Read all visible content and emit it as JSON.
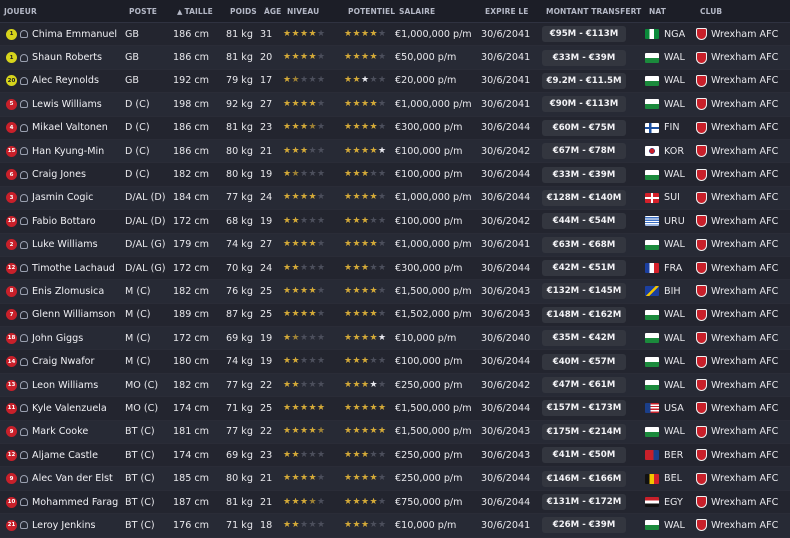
{
  "colors": {
    "accent_star": "#d4aa38",
    "shirt_field": "#c8202a",
    "shirt_gk": "#d7d41c"
  },
  "headers": {
    "joueur": "JOUEUR",
    "poste": "POSTE",
    "taille": "TAILLE",
    "poids": "POIDS",
    "age": "ÂGE",
    "niveau": "NIVEAU",
    "potentiel": "POTENTIEL",
    "salaire": "SALAIRE",
    "expire": "EXPIRE LE",
    "montant": "MONTANT TRANSFERT",
    "nat": "NAT",
    "club": "CLUB",
    "sort_indicator": "▲"
  },
  "players": [
    {
      "num": "1",
      "gk": true,
      "name": "Chima Emmanuel",
      "pos": "GB",
      "height": "186 cm",
      "weight": "81 kg",
      "age": "31",
      "ca": 4,
      "pa": 4,
      "salary": "€1,000,000 p/m",
      "expires": "30/6/2041",
      "value": "€95M - €113M",
      "nat": "NGA",
      "flag": "nga",
      "club": "Wrexham AFC"
    },
    {
      "num": "1",
      "gk": true,
      "name": "Shaun Roberts",
      "pos": "GB",
      "height": "186 cm",
      "weight": "81 kg",
      "age": "20",
      "ca": 4,
      "pa": 4,
      "salary": "€50,000 p/m",
      "expires": "30/6/2041",
      "value": "€33M - €39M",
      "nat": "WAL",
      "flag": "wal",
      "club": "Wrexham AFC"
    },
    {
      "num": "20",
      "gk": true,
      "name": "Alec Reynolds",
      "pos": "GB",
      "height": "192 cm",
      "weight": "79 kg",
      "age": "17",
      "ca": 1.5,
      "pa": 2.5,
      "salary": "€20,000 p/m",
      "expires": "30/6/2041",
      "value": "€9.2M - €11.5M",
      "nat": "WAL",
      "flag": "wal",
      "club": "Wrexham AFC"
    },
    {
      "num": "5",
      "gk": false,
      "name": "Lewis Williams",
      "pos": "D (C)",
      "height": "198 cm",
      "weight": "92 kg",
      "age": "27",
      "ca": 4,
      "pa": 4,
      "salary": "€1,000,000 p/m",
      "expires": "30/6/2041",
      "value": "€90M - €113M",
      "nat": "WAL",
      "flag": "wal",
      "club": "Wrexham AFC"
    },
    {
      "num": "4",
      "gk": false,
      "name": "Mikael Valtonen",
      "pos": "D (C)",
      "height": "186 cm",
      "weight": "81 kg",
      "age": "23",
      "ca": 3.5,
      "pa": 4,
      "salary": "€300,000 p/m",
      "expires": "30/6/2044",
      "value": "€60M - €75M",
      "nat": "FIN",
      "flag": "fin",
      "club": "Wrexham AFC"
    },
    {
      "num": "15",
      "gk": false,
      "name": "Han Kyung-Min",
      "pos": "D (C)",
      "height": "186 cm",
      "weight": "80 kg",
      "age": "21",
      "ca": 3,
      "pa": 4.5,
      "salary": "€100,000 p/m",
      "expires": "30/6/2042",
      "value": "€67M - €78M",
      "nat": "KOR",
      "flag": "kor",
      "club": "Wrexham AFC"
    },
    {
      "num": "6",
      "gk": false,
      "name": "Craig Jones",
      "pos": "D (C)",
      "height": "182 cm",
      "weight": "80 kg",
      "age": "19",
      "ca": 1.5,
      "pa": 3,
      "salary": "€100,000 p/m",
      "expires": "30/6/2044",
      "value": "€33M - €39M",
      "nat": "WAL",
      "flag": "wal",
      "club": "Wrexham AFC"
    },
    {
      "num": "3",
      "gk": false,
      "name": "Jasmin Cogic",
      "pos": "D/AL (D)",
      "height": "184 cm",
      "weight": "77 kg",
      "age": "24",
      "ca": 4,
      "pa": 4,
      "salary": "€1,000,000 p/m",
      "expires": "30/6/2044",
      "value": "€128M - €140M",
      "nat": "SUI",
      "flag": "sui",
      "club": "Wrexham AFC"
    },
    {
      "num": "19",
      "gk": false,
      "name": "Fabio Bottaro",
      "pos": "D/AL (D)",
      "height": "172 cm",
      "weight": "68 kg",
      "age": "19",
      "ca": 2,
      "pa": 3,
      "salary": "€100,000 p/m",
      "expires": "30/6/2042",
      "value": "€44M - €54M",
      "nat": "URU",
      "flag": "uru",
      "club": "Wrexham AFC"
    },
    {
      "num": "2",
      "gk": false,
      "name": "Luke Williams",
      "pos": "D/AL (G)",
      "height": "179 cm",
      "weight": "74 kg",
      "age": "27",
      "ca": 4,
      "pa": 4,
      "salary": "€1,000,000 p/m",
      "expires": "30/6/2041",
      "value": "€63M - €68M",
      "nat": "WAL",
      "flag": "wal",
      "club": "Wrexham AFC"
    },
    {
      "num": "12",
      "gk": false,
      "name": "Timothe Lachaud",
      "pos": "D/AL (G)",
      "height": "172 cm",
      "weight": "70 kg",
      "age": "24",
      "ca": 2,
      "pa": 3,
      "salary": "€300,000 p/m",
      "expires": "30/6/2044",
      "value": "€42M - €51M",
      "nat": "FRA",
      "flag": "fra",
      "club": "Wrexham AFC"
    },
    {
      "num": "8",
      "gk": false,
      "name": "Enis Zlomusica",
      "pos": "M (C)",
      "height": "182 cm",
      "weight": "76 kg",
      "age": "25",
      "ca": 4,
      "pa": 4,
      "salary": "€1,500,000 p/m",
      "expires": "30/6/2043",
      "value": "€132M - €145M",
      "nat": "BIH",
      "flag": "bih",
      "club": "Wrexham AFC"
    },
    {
      "num": "7",
      "gk": false,
      "name": "Glenn Williamson",
      "pos": "M (C)",
      "height": "189 cm",
      "weight": "87 kg",
      "age": "25",
      "ca": 4,
      "pa": 4,
      "salary": "€1,502,000 p/m",
      "expires": "30/6/2043",
      "value": "€148M - €162M",
      "nat": "WAL",
      "flag": "wal",
      "club": "Wrexham AFC"
    },
    {
      "num": "18",
      "gk": false,
      "name": "John Giggs",
      "pos": "M (C)",
      "height": "172 cm",
      "weight": "69 kg",
      "age": "19",
      "ca": 1.5,
      "pa": 4.5,
      "salary": "€10,000 p/m",
      "expires": "30/6/2040",
      "value": "€35M - €42M",
      "nat": "WAL",
      "flag": "wal",
      "club": "Wrexham AFC"
    },
    {
      "num": "14",
      "gk": false,
      "name": "Craig Nwafor",
      "pos": "M (C)",
      "height": "180 cm",
      "weight": "74 kg",
      "age": "19",
      "ca": 2,
      "pa": 3,
      "salary": "€100,000 p/m",
      "expires": "30/6/2044",
      "value": "€40M - €57M",
      "nat": "WAL",
      "flag": "wal",
      "club": "Wrexham AFC"
    },
    {
      "num": "13",
      "gk": false,
      "name": "Leon Williams",
      "pos": "MO (C)",
      "height": "182 cm",
      "weight": "77 kg",
      "age": "22",
      "ca": 2,
      "pa": 3.5,
      "salary": "€250,000 p/m",
      "expires": "30/6/2042",
      "value": "€47M - €61M",
      "nat": "WAL",
      "flag": "wal",
      "club": "Wrexham AFC"
    },
    {
      "num": "11",
      "gk": false,
      "name": "Kyle Valenzuela",
      "pos": "MO (C)",
      "height": "174 cm",
      "weight": "71 kg",
      "age": "25",
      "ca": 5,
      "pa": 5,
      "salary": "€1,500,000 p/m",
      "expires": "30/6/2044",
      "value": "€157M - €173M",
      "nat": "USA",
      "flag": "usa",
      "club": "Wrexham AFC"
    },
    {
      "num": "9",
      "gk": false,
      "name": "Mark Cooke",
      "pos": "BT (C)",
      "height": "181 cm",
      "weight": "77 kg",
      "age": "22",
      "ca": 4.5,
      "pa": 5,
      "salary": "€1,500,000 p/m",
      "expires": "30/6/2043",
      "value": "€175M - €214M",
      "nat": "WAL",
      "flag": "wal",
      "club": "Wrexham AFC"
    },
    {
      "num": "12",
      "gk": false,
      "name": "Aljame Castle",
      "pos": "BT (C)",
      "height": "174 cm",
      "weight": "69 kg",
      "age": "23",
      "ca": 2,
      "pa": 3,
      "salary": "€250,000 p/m",
      "expires": "30/6/2043",
      "value": "€41M - €50M",
      "nat": "BER",
      "flag": "ber",
      "club": "Wrexham AFC"
    },
    {
      "num": "9",
      "gk": false,
      "name": "Alec Van der Elst",
      "pos": "BT (C)",
      "height": "185 cm",
      "weight": "80 kg",
      "age": "21",
      "ca": 4,
      "pa": 4,
      "salary": "€250,000 p/m",
      "expires": "30/6/2044",
      "value": "€146M - €166M",
      "nat": "BEL",
      "flag": "bel",
      "club": "Wrexham AFC"
    },
    {
      "num": "10",
      "gk": false,
      "name": "Mohammed Farag",
      "pos": "BT (C)",
      "height": "187 cm",
      "weight": "81 kg",
      "age": "21",
      "ca": 3.5,
      "pa": 4,
      "salary": "€750,000 p/m",
      "expires": "30/6/2044",
      "value": "€131M - €172M",
      "nat": "EGY",
      "flag": "egy",
      "club": "Wrexham AFC"
    },
    {
      "num": "21",
      "gk": false,
      "name": "Leroy Jenkins",
      "pos": "BT (C)",
      "height": "176 cm",
      "weight": "71 kg",
      "age": "18",
      "ca": 2,
      "pa": 3,
      "salary": "€10,000 p/m",
      "expires": "30/6/2041",
      "value": "€26M - €39M",
      "nat": "WAL",
      "flag": "wal",
      "club": "Wrexham AFC"
    }
  ]
}
